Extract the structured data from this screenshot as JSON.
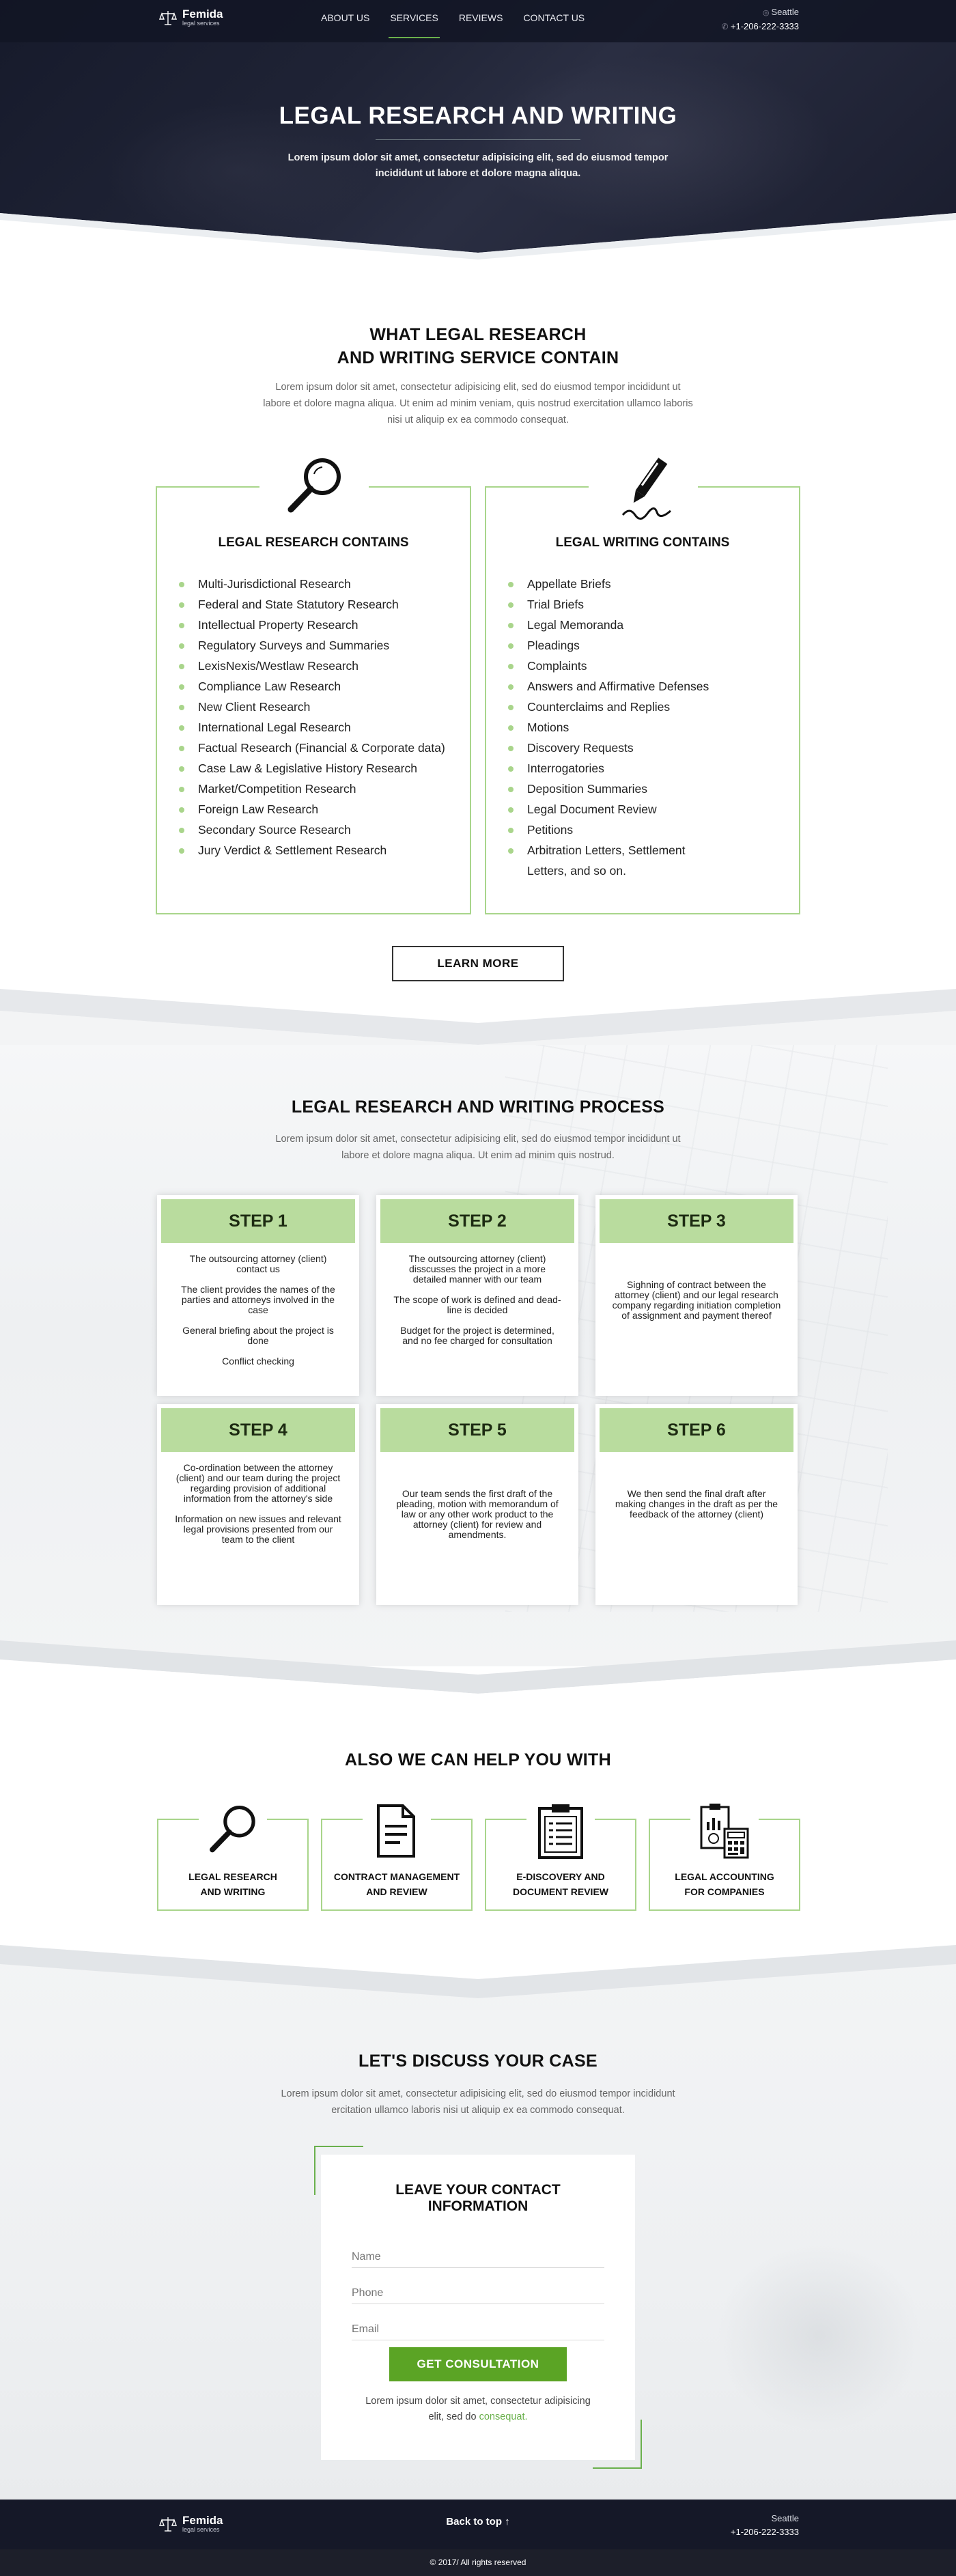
{
  "header": {
    "logo_name": "Femida",
    "logo_sub": "legal services",
    "nav": [
      {
        "label": "ABOUT US"
      },
      {
        "label": "SERVICES"
      },
      {
        "label": "REVIEWS"
      },
      {
        "label": "CONTACT US"
      }
    ],
    "active_nav": "SERVICES",
    "city": "Seattle",
    "phone": "+1-206-222-3333"
  },
  "hero": {
    "title": "LEGAL RESEARCH AND WRITING",
    "text": "Lorem ipsum dolor sit amet, consectetur adipisicing elit, sed do eiusmod tempor incididunt ut labore et dolore magna aliqua."
  },
  "contain": {
    "title_line1": "WHAT LEGAL RESEARCH",
    "title_line2": "AND WRITING SERVICE CONTAIN",
    "text": "Lorem ipsum dolor sit amet, consectetur adipisicing elit, sed do eiusmod tempor incididunt ut labore et dolore magna aliqua. Ut enim ad minim veniam, quis nostrud exercitation ullamco laboris nisi ut aliquip ex ea commodo consequat.",
    "research": {
      "title": "LEGAL RESEARCH CONTAINS",
      "items": [
        "Multi-Jurisdictional Research",
        "Federal and State Statutory Research",
        "Intellectual Property Research",
        "Regulatory Surveys and Summaries",
        "LexisNexis/Westlaw Research",
        "Compliance Law Research",
        "New Client Research",
        "International Legal Research",
        "Factual Research (Financial & Corporate data)",
        "Case Law & Legislative History Research",
        "Market/Competition Research",
        "Foreign Law Research",
        "Secondary Source Research",
        "Jury Verdict & Settlement Research"
      ]
    },
    "writing": {
      "title": "LEGAL WRITING CONTAINS",
      "items": [
        "Appellate Briefs",
        "Trial Briefs",
        "Legal Memoranda",
        "Pleadings",
        "Complaints",
        "Answers and Affirmative Defenses",
        "Counterclaims and Replies",
        "Motions",
        "Discovery Requests",
        "Interrogatories",
        "Deposition Summaries",
        "Legal Document Review",
        "Petitions",
        "Arbitration Letters, Settlement Letters, and so on."
      ]
    },
    "learn_more": "LEARN MORE"
  },
  "process": {
    "title": "LEGAL RESEARCH AND WRITING PROCESS",
    "text": "Lorem ipsum dolor sit amet, consectetur adipisicing elit, sed do eiusmod tempor incididunt ut labore et dolore magna aliqua. Ut enim ad minim quis nostrud.",
    "steps": [
      {
        "title": "STEP 1",
        "paras": [
          "The outsourcing attorney (client) contact us",
          "The client provides the names of the parties and attorneys involved in the case",
          "General briefing about the project is done",
          "Conflict checking"
        ]
      },
      {
        "title": "STEP 2",
        "paras": [
          "The outsourcing attorney (client) disscusses the project in a more detailed manner with our team",
          "The scope of work is defined and dead-line is decided",
          "Budget for the project is determined, and no fee charged for consultation"
        ]
      },
      {
        "title": "STEP 3",
        "paras": [
          "Sighning of contract between the attorney (client) and our legal research company regarding initiation completion of assignment and payment thereof"
        ]
      },
      {
        "title": "STEP 4",
        "paras": [
          "Co-ordination between the attorney (client) and our team during the project regarding provision of additional information from the attorney's side",
          "Information on new issues and relevant legal provisions presented from our team to the client"
        ]
      },
      {
        "title": "STEP 5",
        "paras": [
          "Our team sends the first draft of the pleading, motion with memorandum of law or any other work product to the attorney (client) for review and amendments."
        ]
      },
      {
        "title": "STEP 6",
        "paras": [
          "We then send the final draft after making changes in the draft as per the feedback of the attorney (client)"
        ]
      }
    ]
  },
  "also": {
    "title": "ALSO WE CAN HELP YOU WITH",
    "services": [
      {
        "line1": "LEGAL RESEARCH",
        "line2": "AND WRITING",
        "icon": "magnifier-icon"
      },
      {
        "line1": "CONTRACT MANAGEMENT",
        "line2": "AND REVIEW",
        "icon": "document-icon"
      },
      {
        "line1": "E-DISCOVERY AND",
        "line2": "DOCUMENT REVIEW",
        "icon": "clipboard-icon"
      },
      {
        "line1": "LEGAL ACCOUNTING",
        "line2": "FOR COMPANIES",
        "icon": "calculator-icon"
      }
    ]
  },
  "discuss": {
    "title": "LET'S DISCUSS YOUR CASE",
    "text": "Lorem ipsum dolor sit amet, consectetur adipisicing elit, sed do eiusmod tempor incididunt ercitation ullamco laboris nisi ut aliquip ex ea commodo consequat.",
    "form_title_line1": "LEAVE YOUR CONTACT",
    "form_title_line2": "INFORMATION",
    "name_placeholder": "Name",
    "phone_placeholder": "Phone",
    "email_placeholder": "Email",
    "submit": "GET CONSULTATION",
    "note_text": "Lorem ipsum dolor sit amet, consectetur adipisicing elit, sed do",
    "note_link": "consequat."
  },
  "footer": {
    "logo_name": "Femida",
    "logo_sub": "legal services",
    "back_to_top": "Back to top ↑",
    "city": "Seattle",
    "phone": "+1-206-222-3333",
    "copyright": "© 2017/ All rights reserved"
  },
  "colors": {
    "accent": "#6ab04c",
    "light_green": "#b9dc9e",
    "border_green": "#a9d58b",
    "dark": "#151828"
  }
}
